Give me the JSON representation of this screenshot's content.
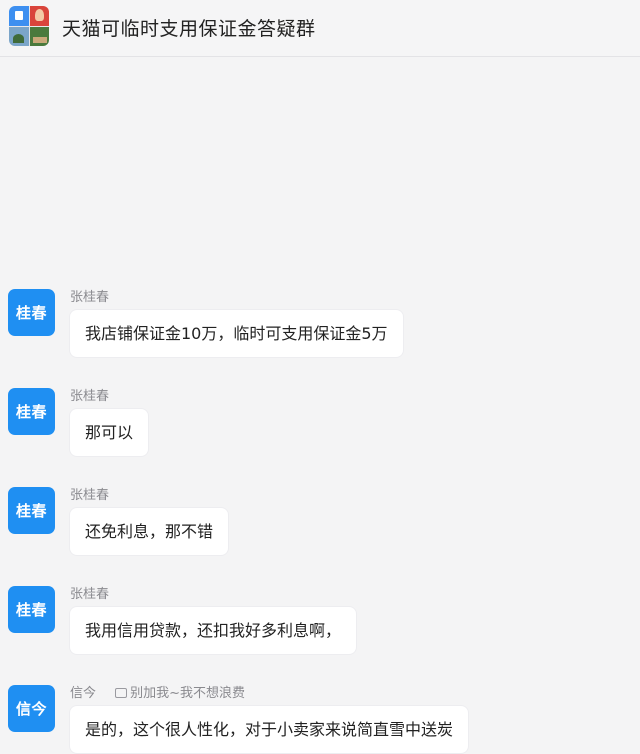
{
  "header": {
    "title": "天猫可临时支用保证金答疑群",
    "group_avatar_icon": "group-avatar-icon"
  },
  "messages": [
    {
      "avatar_text": "桂春",
      "sender": "张桂春",
      "note": "",
      "text": "我店铺保证金10万，临时可支用保证金5万"
    },
    {
      "avatar_text": "桂春",
      "sender": "张桂春",
      "note": "",
      "text": "那可以"
    },
    {
      "avatar_text": "桂春",
      "sender": "张桂春",
      "note": "",
      "text": "还免利息，那不错"
    },
    {
      "avatar_text": "桂春",
      "sender": "张桂春",
      "note": "",
      "text": "我用信用贷款，还扣我好多利息啊，"
    },
    {
      "avatar_text": "信今",
      "sender": "信今",
      "note": "别加我~我不想浪费",
      "text": "是的，这个很人性化，对于小卖家来说简直雪中送炭"
    }
  ],
  "colors": {
    "avatar_blue": "#1f8ff2",
    "page_bg": "#f4f4f5",
    "bubble_bg": "#ffffff"
  }
}
